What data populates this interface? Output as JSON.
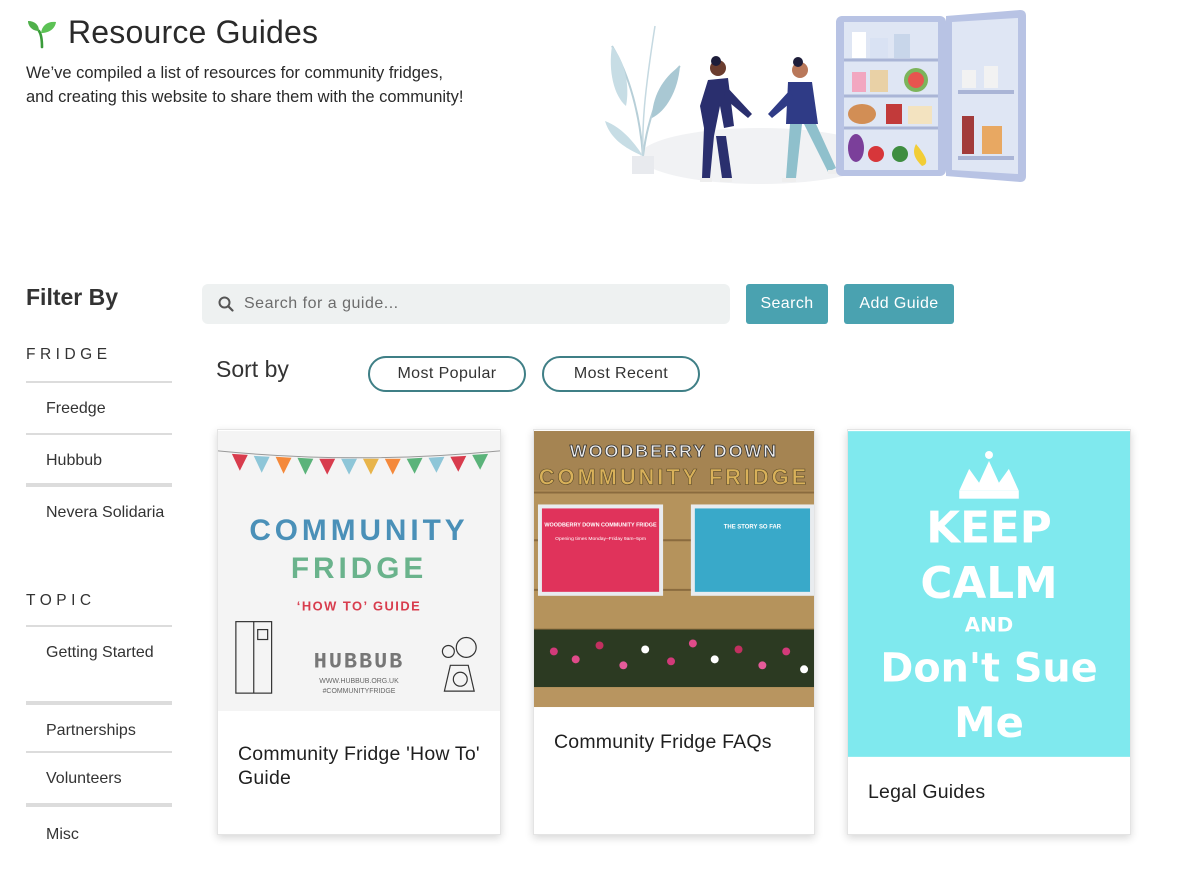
{
  "hero": {
    "title": "Resource Guides",
    "description": "We’ve compiled a list of resources for community fridges, and creating this website to share them with the community!"
  },
  "filters": {
    "heading": "Filter By",
    "groups": [
      {
        "label": "FRIDGE",
        "items": [
          "Freedge",
          "Hubbub",
          "Nevera Solidaria"
        ]
      },
      {
        "label": "TOPIC",
        "items": [
          "Getting Started",
          "Partnerships",
          "Volunteers",
          "Misc"
        ]
      }
    ]
  },
  "search": {
    "placeholder": "Search for a guide...",
    "search_label": "Search",
    "add_label": "Add Guide"
  },
  "sort": {
    "label": "Sort by",
    "options": [
      "Most Popular",
      "Most Recent"
    ]
  },
  "cards": [
    {
      "title": "Community Fridge 'How To' Guide",
      "image": {
        "line1": "COMMUNITY",
        "line2": "FRIDGE",
        "subtitle": "‘HOW TO’ GUIDE",
        "brand": "HUBBUB",
        "url": "WWW.HUBBUB.ORG.UK",
        "tag": "#COMMUNITYFRIDGE"
      }
    },
    {
      "title": "Community Fridge FAQs",
      "image": {
        "sign1": "WOODBERRY DOWN",
        "sign2": "COMMUNITY FRIDGE",
        "poster_left_title": "WOODBERRY DOWN COMMUNITY FRIDGE",
        "poster_left_sub": "Opening times Monday–Friday 9am–5pm",
        "poster_right_title": "THE STORY SO FAR"
      }
    },
    {
      "title": "Legal Guides",
      "image": {
        "line1": "KEEP",
        "line2": "CALM",
        "line3": "AND",
        "line4": "Don't Sue",
        "line5": "Me"
      }
    }
  ],
  "colors": {
    "accent": "#4aa2b0",
    "pill_border": "#3f7f86",
    "search_bg": "#eef1f1",
    "keep_calm_bg": "#7fe9ee"
  }
}
